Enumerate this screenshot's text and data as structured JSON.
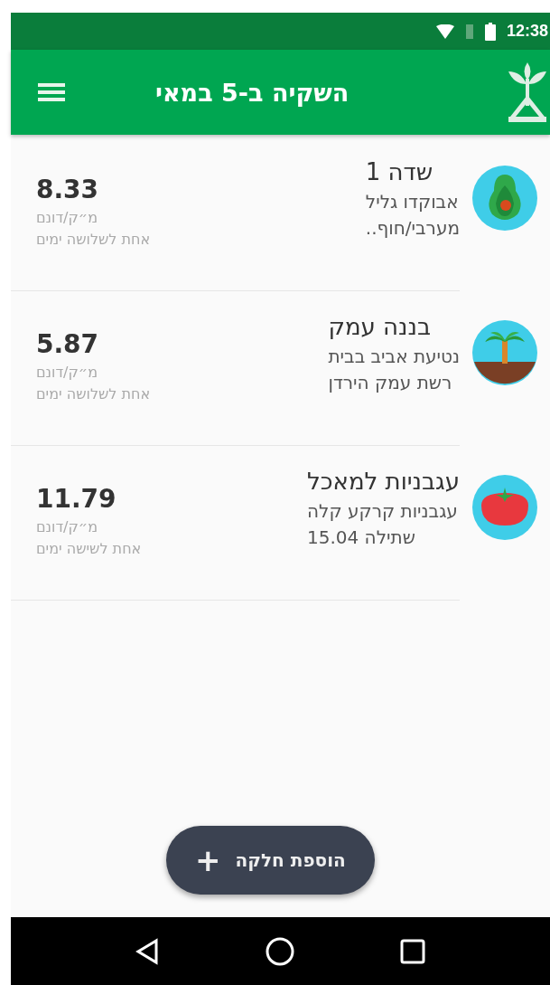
{
  "status_bar": {
    "time": "12:38"
  },
  "app_bar": {
    "title": "השקיה ב-5 במאי"
  },
  "fields": [
    {
      "kind": "avocado",
      "name": "שדה 1",
      "line_1": "אבוקדו גליל",
      "line_2": "מערבי/חוף..",
      "amount": "8.33",
      "unit": "מ״ק/דונם",
      "frequency": "אחת לשלושה ימים"
    },
    {
      "kind": "palm",
      "name": "בננה עמק",
      "line_1": "נטיעת אביב בבית",
      "line_2": "רשת עמק הירדן",
      "amount": "5.87",
      "unit": "מ״ק/דונם",
      "frequency": "אחת לשלושה ימים"
    },
    {
      "kind": "tomato",
      "name": "עגבניות למאכל",
      "line_1": "עגבניות קרקע קלה",
      "line_2": "שתילה 15.04",
      "amount": "11.79",
      "unit": "מ״ק/דונם",
      "frequency": "אחת לשישה ימים"
    }
  ],
  "add_button": {
    "label": "הוספת חלקה",
    "icon": "+"
  }
}
